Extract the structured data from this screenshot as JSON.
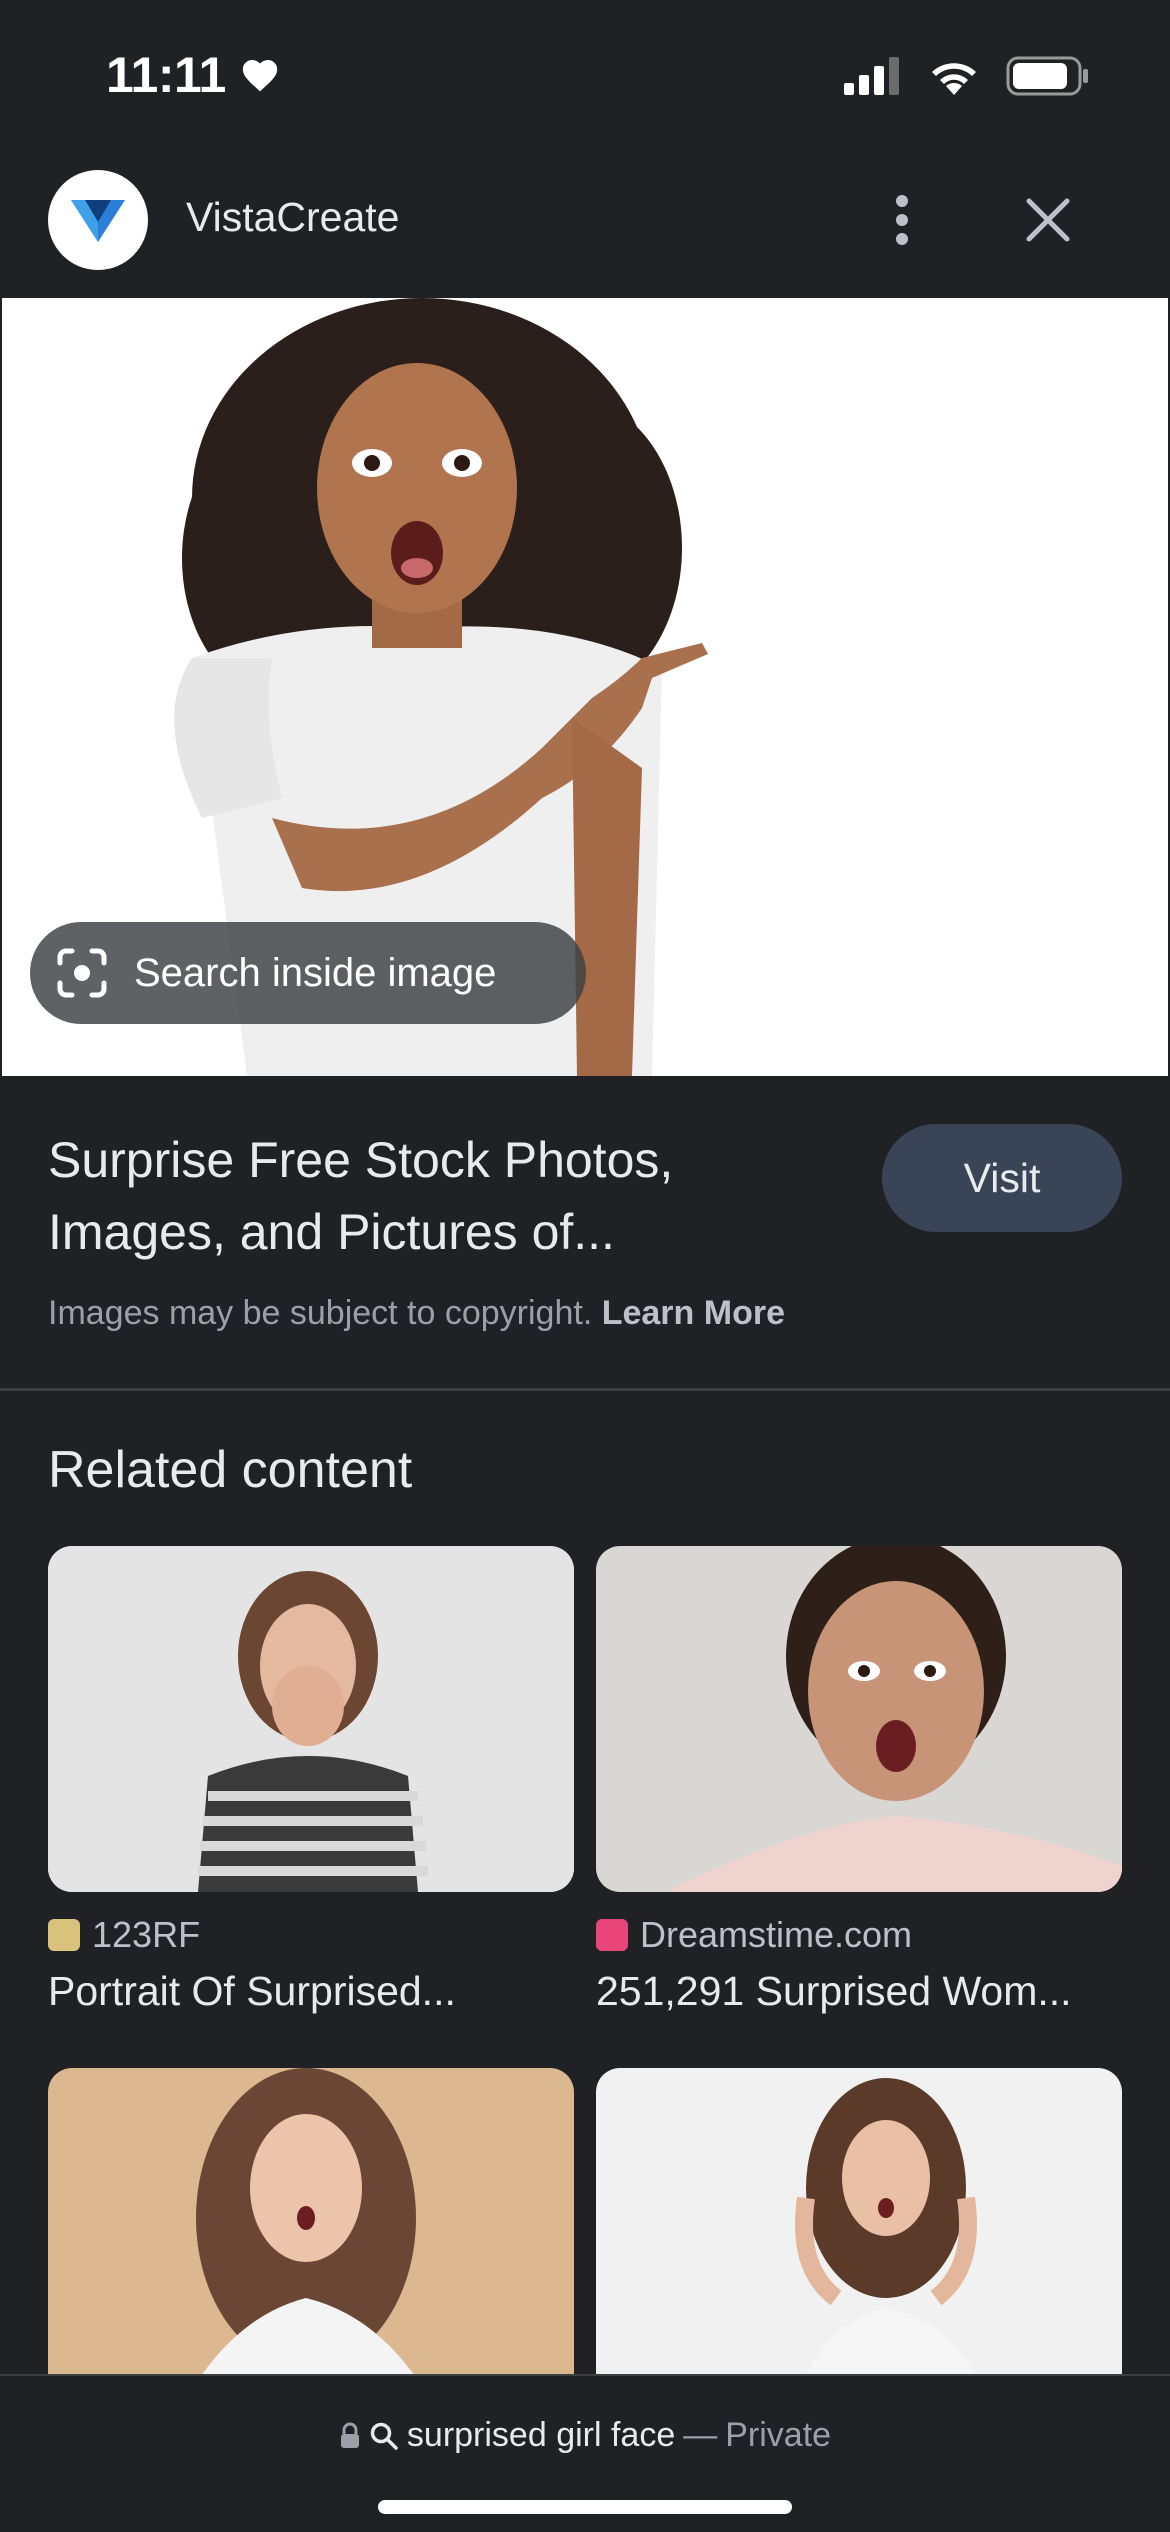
{
  "status_bar": {
    "time": "11:11",
    "icons": [
      "heart-icon",
      "signal-icon",
      "wifi-icon",
      "battery-icon"
    ]
  },
  "header": {
    "site_name": "VistaCreate",
    "icons": [
      "vistacreate-logo-icon",
      "more-vert-icon",
      "close-icon"
    ]
  },
  "hero": {
    "search_inside_label": "Search inside image"
  },
  "result": {
    "title_line1": "Surprise Free Stock Photos,",
    "title_line2": "Images, and Pictures of...",
    "visit_label": "Visit",
    "copyright_text": "Images may be subject to copyright.",
    "learn_more": "Learn More"
  },
  "related": {
    "heading": "Related content",
    "items": [
      {
        "source": "123RF",
        "title": "Portrait Of Surprised..."
      },
      {
        "source": "Dreamstime.com",
        "title": "251,291 Surprised Wom..."
      },
      {
        "source": "",
        "title": ""
      },
      {
        "source": "",
        "title": ""
      }
    ]
  },
  "bottom_bar": {
    "query": "surprised girl face",
    "separator": "—",
    "private_label": "Private",
    "icons": [
      "lock-icon",
      "search-icon"
    ]
  },
  "colors": {
    "background": "#202124",
    "visit_button": "#394457",
    "text_primary": "#e8eaed",
    "text_secondary": "#9aa0a6"
  }
}
